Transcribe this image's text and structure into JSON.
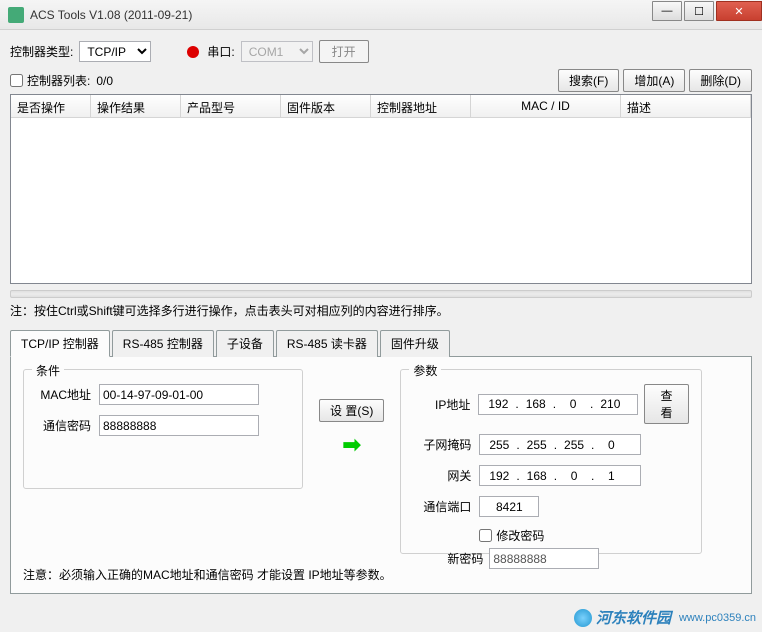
{
  "window": {
    "title": "ACS Tools V1.08 (2011-09-21)"
  },
  "topRow": {
    "controllerTypeLabel": "控制器类型:",
    "controllerTypeValue": "TCP/IP",
    "serialLabel": "串口:",
    "comValue": "COM1",
    "openBtn": "打开"
  },
  "secondRow": {
    "listLabel": "控制器列表:",
    "countText": "0/0",
    "searchBtn": "搜索(F)",
    "addBtn": "增加(A)",
    "deleteBtn": "删除(D)"
  },
  "table": {
    "cols": [
      "是否操作",
      "操作结果",
      "产品型号",
      "固件版本",
      "控制器地址",
      "MAC / ID",
      "描述"
    ]
  },
  "note1": "注：按住Ctrl或Shift键可选择多行进行操作，点击表头可对相应列的内容进行排序。",
  "tabs": [
    "TCP/IP 控制器",
    "RS-485 控制器",
    "子设备",
    "RS-485 读卡器",
    "固件升级"
  ],
  "panel": {
    "conditionsLegend": "条件",
    "macLabel": "MAC地址",
    "macValue": "00-14-97-09-01-00",
    "pwdLabel": "通信密码",
    "pwdValue": "88888888",
    "setBtn": "设 置(S)",
    "paramsLegend": "参数",
    "ipLabel": "IP地址",
    "ip": [
      "192",
      "168",
      "0",
      "210"
    ],
    "viewBtn": "查看",
    "maskLabel": "子网掩码",
    "mask": [
      "255",
      "255",
      "255",
      "0"
    ],
    "gwLabel": "网关",
    "gw": [
      "192",
      "168",
      "0",
      "1"
    ],
    "portLabel": "通信端口",
    "portValue": "8421",
    "changePwdLabel": "修改密码",
    "newPwdLabel": "新密码",
    "newPwdValue": "88888888"
  },
  "note2": "注意：必须输入正确的MAC地址和通信密码 才能设置 IP地址等参数。",
  "watermark": {
    "name": "河东软件园",
    "url": "www.pc0359.cn"
  }
}
